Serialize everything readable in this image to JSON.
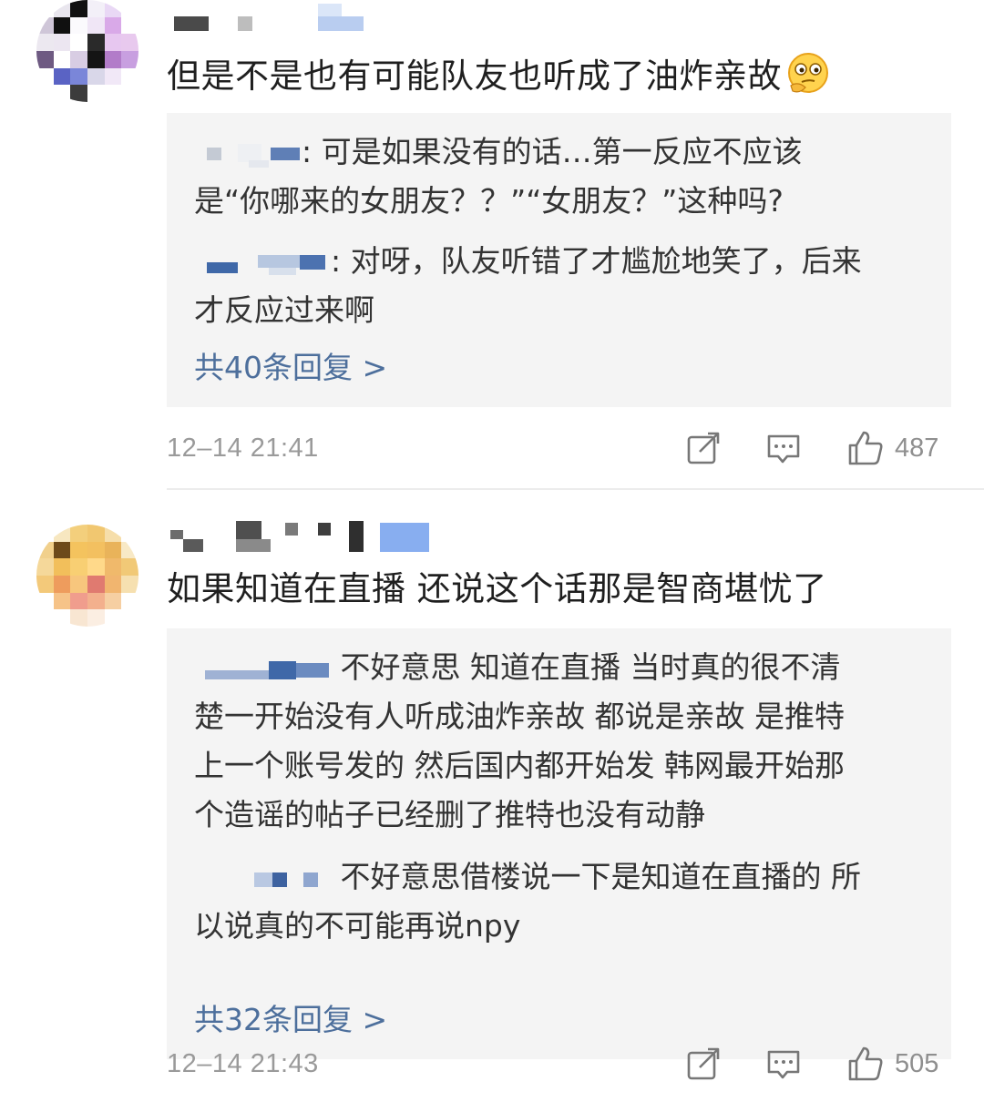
{
  "comments": [
    {
      "text": "但是不是也有可能队友也听成了油炸亲故",
      "emoji": "thinking-face-emoji",
      "replies": [
        {
          "lines": [
            ": 可是如果没有的话…第一反应不应该",
            "是“你哪来的女朋友？？”“女朋友？”这种吗?"
          ]
        },
        {
          "lines": [
            ": 对呀，队友听错了才尴尬地笑了，后来",
            "才反应过来啊"
          ]
        }
      ],
      "more_replies": "共40条回复 >",
      "timestamp": "12–14 21:41",
      "like_count": "487"
    },
    {
      "text": "如果知道在直播 还说这个话那是智商堪忧了",
      "replies": [
        {
          "lines": [
            " 不好意思 知道在直播 当时真的很不清",
            "楚一开始没有人听成油炸亲故 都说是亲故  是推特",
            "上一个账号发的 然后国内都开始发 韩网最开始那",
            "个造谣的帖子已经删了推特也没有动静"
          ]
        },
        {
          "lines": [
            " 不好意思借楼说一下是知道在直播的 所",
            "以说真的不可能再说npy"
          ]
        }
      ],
      "more_replies": "共32条回复 >",
      "timestamp": "12–14 21:43",
      "like_count": "505"
    }
  ],
  "icons": {
    "repost": "share-edit-icon",
    "comment": "comment-icon",
    "like": "thumbs-up-icon"
  },
  "colors": {
    "link": "#4d6f9c",
    "reply_bg": "#f4f4f4",
    "meta": "#9a9a9a"
  }
}
